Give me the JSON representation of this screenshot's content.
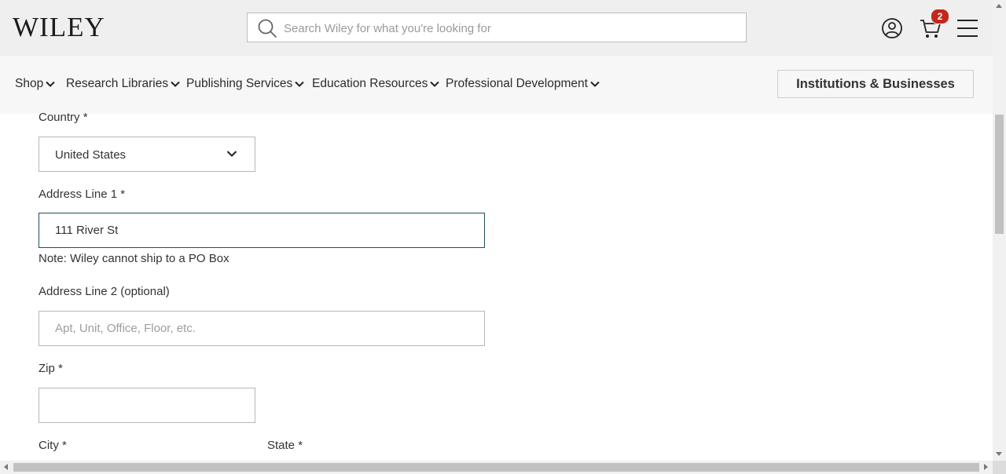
{
  "header": {
    "logo": "WILEY",
    "search_placeholder": "Search Wiley for what you're looking for",
    "cart_count": "2"
  },
  "nav": {
    "items": [
      {
        "label": "Shop"
      },
      {
        "label": "Research Libraries"
      },
      {
        "label": "Publishing Services"
      },
      {
        "label": "Education Resources"
      },
      {
        "label": "Professional Development"
      }
    ],
    "institutions_button": "Institutions & Businesses"
  },
  "form": {
    "country_label": "Country *",
    "country_value": "United States",
    "address1_label": "Address Line 1 *",
    "address1_value": "111 River St",
    "address1_note": "Note: Wiley cannot ship to a PO Box",
    "address2_label": "Address Line 2 (optional)",
    "address2_placeholder": "Apt, Unit, Office, Floor, etc.",
    "zip_label": "Zip *",
    "zip_value": "",
    "city_label": "City *",
    "state_label": "State *"
  },
  "colors": {
    "header_bg": "#efefef",
    "nav_bg": "#f7f7f7",
    "badge": "#c3281c",
    "focus_border": "#1f4e5f"
  }
}
